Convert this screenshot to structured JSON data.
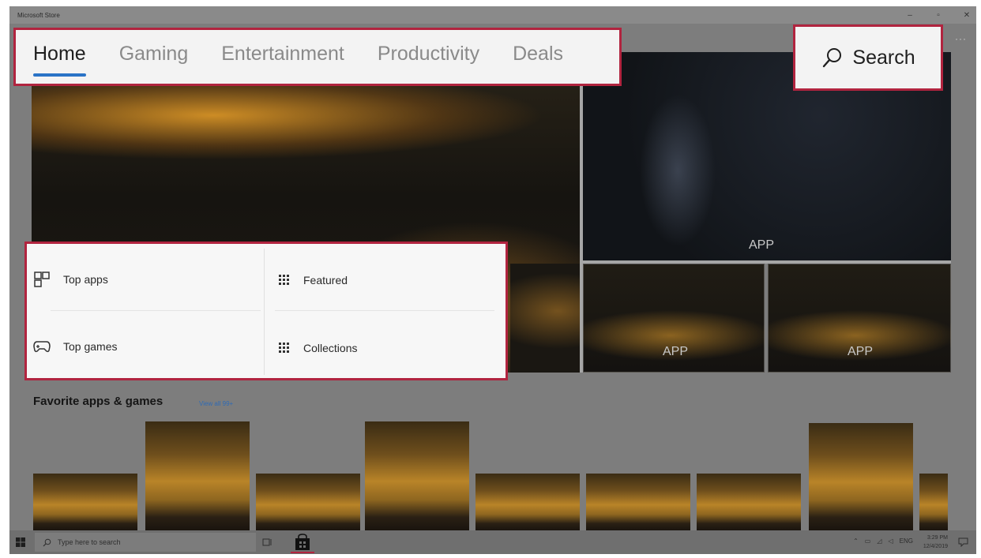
{
  "window": {
    "title": "Microsoft Store",
    "controls": {
      "minimize": "–",
      "maximize": "▫",
      "close": "✕"
    },
    "more": "···"
  },
  "nav": {
    "tabs": [
      {
        "label": "Home",
        "active": true
      },
      {
        "label": "Gaming"
      },
      {
        "label": "Entertainment"
      },
      {
        "label": "Productivity"
      },
      {
        "label": "Deals"
      }
    ]
  },
  "search": {
    "label": "Search",
    "icon": "search-icon"
  },
  "hero": {
    "tile_labels": [
      "APP",
      "APP",
      "APP"
    ]
  },
  "categories": {
    "items": [
      {
        "label": "Top apps",
        "icon": "top-apps-icon"
      },
      {
        "label": "Featured",
        "icon": "grid-icon"
      },
      {
        "label": "Top games",
        "icon": "gamepad-icon"
      },
      {
        "label": "Collections",
        "icon": "grid-icon"
      }
    ]
  },
  "favorites": {
    "title": "Favorite apps & games",
    "link": "View all 99+"
  },
  "taskbar": {
    "search_placeholder": "Type here to search",
    "language": "ENG",
    "time": "3:29 PM",
    "date": "12/4/2019"
  },
  "colors": {
    "highlight": "#b1243f",
    "accent": "#2a73c6"
  }
}
